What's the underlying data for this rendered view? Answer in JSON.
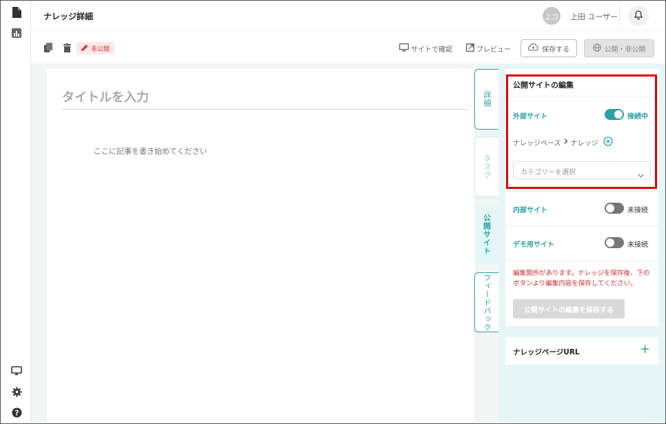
{
  "rail": {
    "top_icons": [
      "document-icon",
      "chart-icon"
    ],
    "bottom_icons": [
      "monitor-icon",
      "gear-icon",
      "help-icon"
    ]
  },
  "header": {
    "title": "ナレッジ詳細",
    "avatar_initials": "上コ",
    "user_name": "上田 ユーザー"
  },
  "toolbar": {
    "status_label": "非公開",
    "view_site_label": "サイトで確認",
    "preview_label": "プレビュー",
    "save_label": "保存する",
    "publish_label": "公開・非公開"
  },
  "editor": {
    "title_placeholder": "タイトルを入力",
    "body_placeholder": "ここに記事を書き始めてください"
  },
  "tabs": [
    {
      "label": "詳細",
      "state": "outlined"
    },
    {
      "label": "タスク",
      "state": "muted"
    },
    {
      "label": "公開サイト",
      "state": "active"
    },
    {
      "label": "フィードバック",
      "state": "outlined"
    }
  ],
  "panel": {
    "heading": "公開サイトの編集",
    "external": {
      "label": "外部サイト",
      "status": "接続中",
      "on": true
    },
    "breadcrumb": {
      "parent": "ナレッジベース",
      "child": "ナレッジ"
    },
    "category_placeholder": "カテゴリーを選択",
    "internal": {
      "label": "内部サイト",
      "status": "未接続",
      "on": false
    },
    "demo": {
      "label": "デモ用サイト",
      "status": "未接続",
      "on": false
    },
    "warning": "編集箇所があります。ナレッジを保存後、下のボタンより編集内容を保存してください。",
    "save_site_label": "公開サイトの編集を保存する",
    "url_heading": "ナレッジページURL",
    "url_add": "+"
  },
  "colors": {
    "accent": "#2aa1a4",
    "warning": "#d32f2f",
    "highlight": "#e00000"
  }
}
